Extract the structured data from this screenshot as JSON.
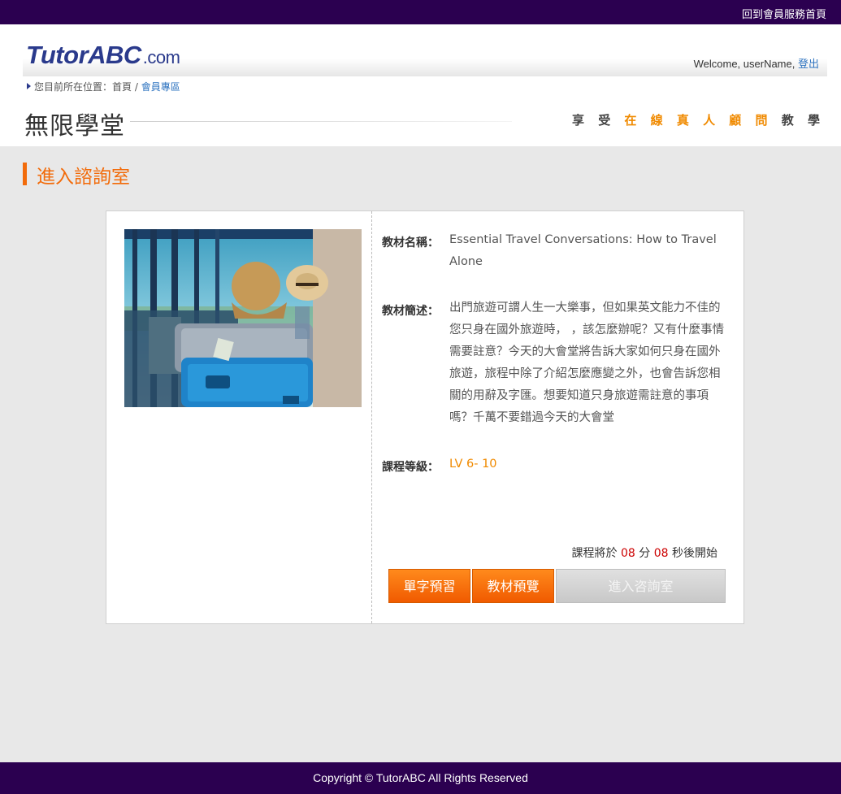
{
  "topbar": {
    "link_label": "回到會員服務首頁"
  },
  "header": {
    "logo_main": "TutorABC",
    "logo_suffix": ".com",
    "welcome_text": "Welcome, userName,",
    "logout_label": "登出",
    "breadcrumb_prefix": "您目前所在位置：首頁 /",
    "breadcrumb_current": "會員專區",
    "page_title": "無限學堂",
    "slogan": {
      "a": "享 受 ",
      "b": "在 線 真 人 顧 問",
      "c": " 教 學"
    }
  },
  "section": {
    "title": "進入諮詢室"
  },
  "course": {
    "name_label": "教材名稱：",
    "name_value": "Essential Travel Conversations: How to Travel Alone",
    "desc_label": "教材簡述：",
    "desc_value": "出門旅遊可謂人生一大樂事，但如果英文能力不佳的您只身在國外旅遊時， ，該怎麼辦呢？又有什麼事情需要註意？今天的大會堂將告訴大家如何只身在國外旅遊，旅程中除了介紹怎麼應變之外，也會告訴您相關的用辭及字匯。想要知道只身旅遊需註意的事項嗎？千萬不要錯過今天的大會堂",
    "level_label": "課程等級：",
    "level_value": "LV 6- 10"
  },
  "countdown": {
    "prefix": "課程將於",
    "minutes": "08",
    "min_unit": "分",
    "seconds": "08",
    "suffix": "秒後開始"
  },
  "buttons": {
    "vocab": "單字預習",
    "preview": "教材預覽",
    "enter": "進入咨詢室"
  },
  "colors": {
    "brand_purple": "#2b0050",
    "accent_orange": "#f26b0a"
  },
  "footer": {
    "copyright": "Copyright © TutorABC All Rights Reserved"
  }
}
